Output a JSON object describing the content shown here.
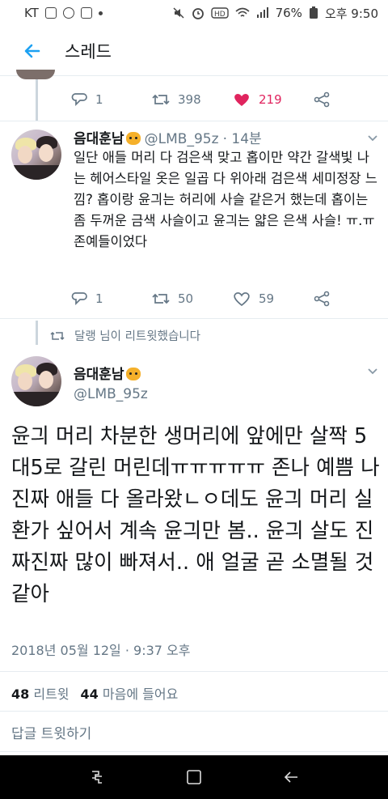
{
  "status_bar": {
    "carrier": "KT",
    "battery": "76%",
    "time": "오후 9:50"
  },
  "header": {
    "title": "스레드"
  },
  "tweet1_actions": {
    "reply_count": "1",
    "retweet_count": "398",
    "like_count": "219",
    "liked_color": "#e0245e"
  },
  "tweet2": {
    "name": "음대훈남",
    "handle": "@LMB_95z",
    "time": "· 14분",
    "text": "일단 애들 머리 다 검은색 맞고 홉이만 약간 갈색빛 나는 헤어스타일 옷은 일곱 다 위아래 검은색 세미정장 느낌? 홉이랑 윤긔는 허리에 사슬 같은거 했는데 홉이는 좀 두꺼운 금색 사슬이고 윤긔는 얇은 은색 사슬! ㅠ.ㅠ 존예들이었다",
    "reply_count": "1",
    "retweet_count": "50",
    "like_count": "59"
  },
  "retweet_note": {
    "text": "달랭 님이 리트윗했습니다"
  },
  "main_tweet": {
    "name": "음대훈남",
    "handle": "@LMB_95z",
    "text": "윤긔 머리 차분한 생머리에 앞에만 살짝 5대5로 갈린 머린데ㅠㅠㅠㅠㅠ 존나 예쁨 나 진짜 애들 다 올라왔ㄴㅇ데도 윤긔 머리 실환가 싶어서 계속 윤긔만 봄.. 윤긔 살도 진짜진짜 많이 빠져서.. 애 얼굴 곧 소멸될 것 같아",
    "timestamp": "2018년 05월 12일 · 9:37 오후",
    "retweets_count": "48",
    "retweets_label": "리트윗",
    "likes_count": "44",
    "likes_label": "마음에 들어요"
  },
  "reply_box": {
    "placeholder": "답글 트윗하기"
  },
  "colors": {
    "accent": "#1da1f2",
    "secondary_text": "#657786",
    "heart": "#e0245e"
  },
  "icons": [
    "back-arrow-icon",
    "reply-icon",
    "retweet-icon",
    "heart-icon",
    "share-icon",
    "chevron-down-icon",
    "recent-apps-icon",
    "home-icon",
    "nav-back-icon"
  ]
}
